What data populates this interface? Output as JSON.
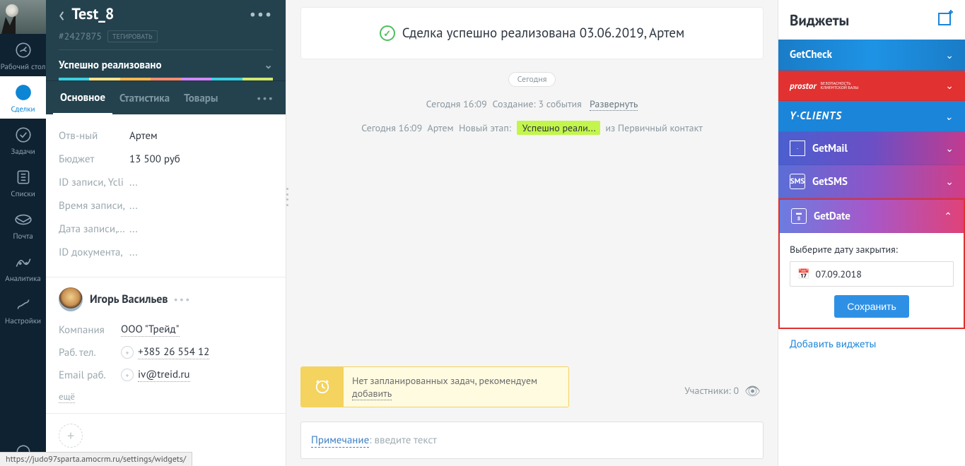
{
  "nav": {
    "items": [
      {
        "label": "Рабочий стол"
      },
      {
        "label": "Сделки"
      },
      {
        "label": "Задачи"
      },
      {
        "label": "Списки"
      },
      {
        "label": "Почта"
      },
      {
        "label": "Аналитика"
      },
      {
        "label": "Настройки"
      }
    ]
  },
  "deal": {
    "title": "Test_8",
    "id": "#2427875",
    "tag_button": "ТЕГИРОВАТЬ",
    "status": "Успешно реализовано",
    "tabs": [
      {
        "label": "Основное"
      },
      {
        "label": "Статистика"
      },
      {
        "label": "Товары"
      }
    ],
    "fields": [
      {
        "label": "Отв-ный",
        "value": "Артем"
      },
      {
        "label": "Бюджет",
        "value": "13 500 руб"
      },
      {
        "label": "ID записи, Ycli",
        "value": "..."
      },
      {
        "label": "Время записи,",
        "value": "..."
      },
      {
        "label": "Дата записи, Y",
        "value": "..."
      },
      {
        "label": "ID документа,",
        "value": "..."
      }
    ],
    "pipeline_colors": [
      "#3bd0e0",
      "#ffe38a",
      "#ffb74d",
      "#ff8d6e",
      "#d288ff",
      "#3bd0e0",
      "#cfe86e"
    ]
  },
  "contact": {
    "name": "Игорь Васильев",
    "company_label": "Компания",
    "company_value": "ООО \"Трейд\"",
    "phone_label": "Раб. тел.",
    "phone_value": "+385 26 554 12",
    "email_label": "Email раб.",
    "email_value": "iv@treid.ru",
    "more": "ещё"
  },
  "feed": {
    "success_text": "Сделка успешно реализована 03.06.2019, Артем",
    "day_label": "Сегодня",
    "events": [
      {
        "time": "Сегодня 16:09",
        "text": "Создание: 3 события",
        "expand": "Развернуть"
      },
      {
        "time": "Сегодня 16:09",
        "author": "Артем",
        "prefix": "Новый этап:",
        "stage": "Успешно реали...",
        "suffix": "из Первичный контакт"
      }
    ],
    "task_warning": {
      "text": "Нет запланированных задач, рекомендуем ",
      "add": "добавить"
    },
    "participants": {
      "label": "Участники:",
      "count": "0"
    },
    "note": {
      "label": "Примечание",
      "placeholder": ": введите текст"
    }
  },
  "widgets": {
    "title": "Виджеты",
    "list": [
      {
        "name": "GetCheck"
      },
      {
        "name": "prostor",
        "sub": "БЕЗОПАСНОСТЬ КЛИЕНТСКОЙ БАЗЫ"
      },
      {
        "name": "Y·CLIENTS"
      },
      {
        "name": "GetMail"
      },
      {
        "name": "GetSMS"
      },
      {
        "name": "GetDate"
      }
    ],
    "getdate": {
      "label": "Выберите дату закрытия:",
      "value": "07.09.2018",
      "save": "Сохранить"
    },
    "add_link": "Добавить виджеты"
  },
  "status_bar_url": "https://judo97sparta.amocrm.ru/settings/widgets/"
}
